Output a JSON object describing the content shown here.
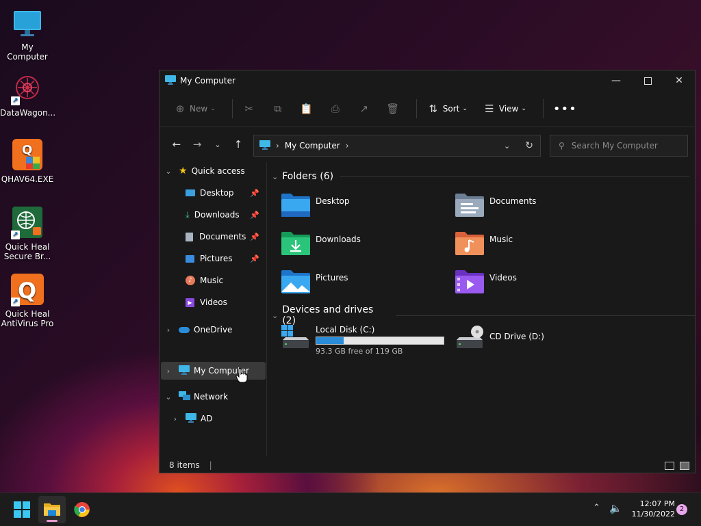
{
  "desktop": {
    "icons": [
      {
        "label": "My Computer"
      },
      {
        "label": "DataWagon..."
      },
      {
        "label": "QHAV64.EXE"
      },
      {
        "label": "Quick Heal Secure Br..."
      },
      {
        "label": "Quick Heal AntiVirus Pro"
      }
    ]
  },
  "window": {
    "title": "My Computer",
    "toolbar": {
      "new_label": "New",
      "sort_label": "Sort",
      "view_label": "View"
    },
    "address": {
      "crumb": "My Computer"
    },
    "search": {
      "placeholder": "Search My Computer"
    },
    "sidebar": {
      "quick_access": "Quick access",
      "items": [
        {
          "label": "Desktop"
        },
        {
          "label": "Downloads"
        },
        {
          "label": "Documents"
        },
        {
          "label": "Pictures"
        },
        {
          "label": "Music"
        },
        {
          "label": "Videos"
        }
      ],
      "onedrive": "OneDrive",
      "my_computer": "My Computer",
      "network": "Network",
      "ad": "AD"
    },
    "main": {
      "folders_header": "Folders (6)",
      "folders": [
        {
          "label": "Desktop"
        },
        {
          "label": "Documents"
        },
        {
          "label": "Downloads"
        },
        {
          "label": "Music"
        },
        {
          "label": "Pictures"
        },
        {
          "label": "Videos"
        }
      ],
      "devices_header": "Devices and drives (2)",
      "local_disk": {
        "label": "Local Disk (C:)",
        "free_text": "93.3 GB free of 119 GB",
        "used_fraction": 0.216
      },
      "cd_drive": {
        "label": "CD Drive (D:)"
      }
    },
    "status": {
      "items_text": "8 items"
    }
  },
  "taskbar": {
    "time": "12:07 PM",
    "date": "11/30/2022",
    "notification_count": "2"
  },
  "colors": {
    "accent": "#2a8cd8",
    "window_bg": "#191919",
    "selected_bg": "#3a3a3a"
  }
}
